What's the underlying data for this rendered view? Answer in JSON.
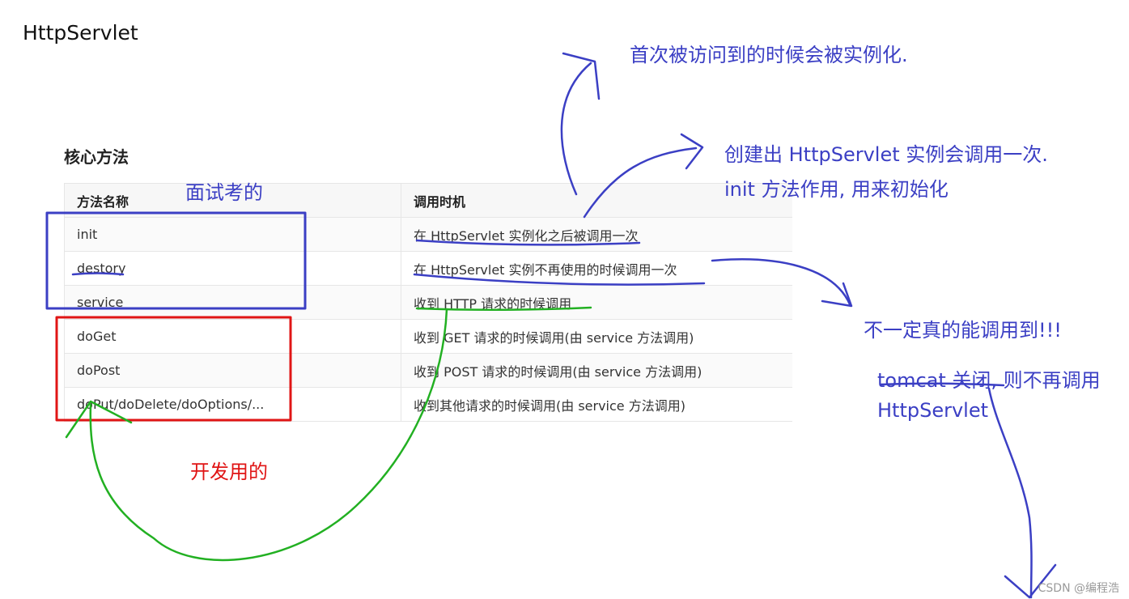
{
  "page": {
    "title": "HttpServlet",
    "section_heading": "核心方法",
    "watermark": "CSDN @编程浩"
  },
  "table": {
    "headers": [
      "方法名称",
      "调用时机"
    ],
    "rows": [
      [
        "init",
        "在 HttpServlet 实例化之后被调用一次"
      ],
      [
        "destory",
        "在 HttpServlet 实例不再使用的时候调用一次"
      ],
      [
        "service",
        "收到 HTTP 请求的时候调用"
      ],
      [
        "doGet",
        "收到 GET 请求的时候调用(由 service 方法调用)"
      ],
      [
        "doPost",
        "收到 POST 请求的时候调用(由 service 方法调用)"
      ],
      [
        "doPut/doDelete/doOptions/...",
        "收到其他请求的时候调用(由 service 方法调用)"
      ]
    ]
  },
  "annotations": {
    "first_access": "首次被访问到的时候会被实例化.",
    "init_line1": "创建出 HttpServlet 实例会调用一次.",
    "init_line2": "init 方法作用, 用来初始化",
    "interview": "面试考的",
    "not_guaranteed": "不一定真的能调用到!!!",
    "tomcat_line1": "tomcat 关闭, 则不再调用",
    "tomcat_line2": "HttpServlet",
    "development": "开发用的"
  },
  "colors": {
    "blue_ink": "#3b3fc4",
    "red_ink": "#e01515",
    "green_ink": "#22b022"
  }
}
